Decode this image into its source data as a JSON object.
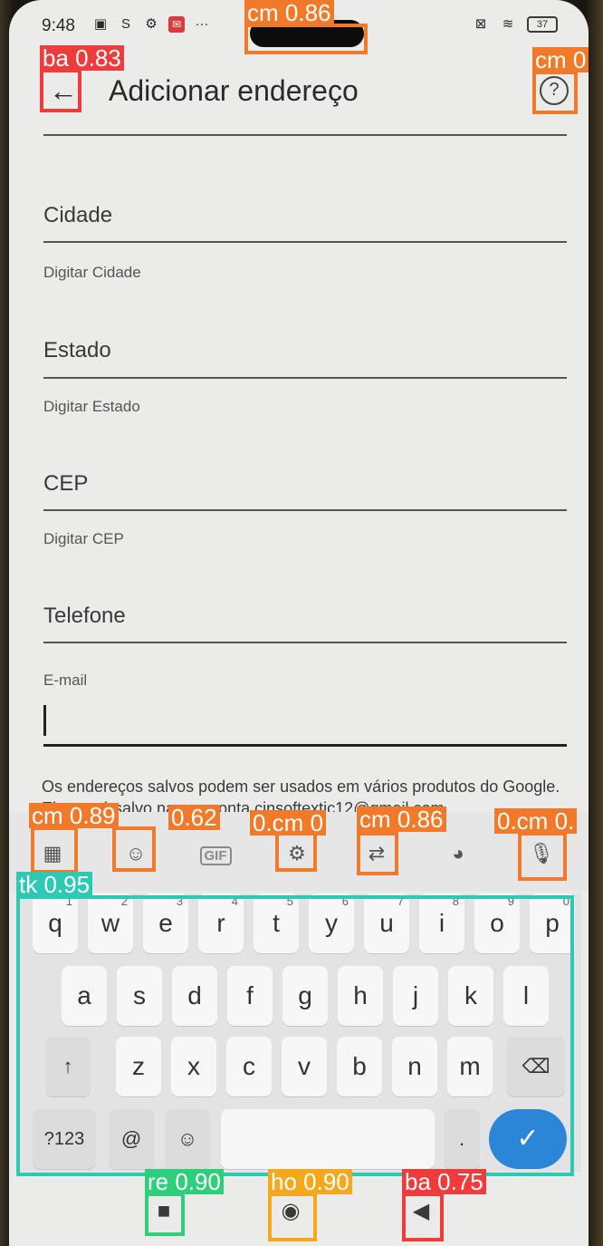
{
  "status": {
    "time": "9:48",
    "battery": "37",
    "left_icons": [
      "nfc-icon",
      "s-icon",
      "gear-icon",
      "mail-icon",
      "more-icon"
    ],
    "right_icons": [
      "sim-icon",
      "wifi-icon",
      "battery-icon"
    ]
  },
  "app_bar": {
    "title": "Adicionar endereço"
  },
  "form": {
    "cidade_label": "Cidade",
    "cidade_hint": "Digitar Cidade",
    "estado_label": "Estado",
    "estado_hint": "Digitar Estado",
    "cep_label": "CEP",
    "cep_hint": "Digitar CEP",
    "telefone_label": "Telefone",
    "email_label": "E-mail",
    "email_value": "",
    "disclaimer": "Os endereços salvos podem ser usados em vários produtos do Google. Eles será salvo na sua conta cinsoftextic12@gmail.com"
  },
  "keyboard": {
    "row1": [
      {
        "k": "q",
        "n": "1"
      },
      {
        "k": "w",
        "n": "2"
      },
      {
        "k": "e",
        "n": "3"
      },
      {
        "k": "r",
        "n": "4"
      },
      {
        "k": "t",
        "n": "5"
      },
      {
        "k": "y",
        "n": "6"
      },
      {
        "k": "u",
        "n": "7"
      },
      {
        "k": "i",
        "n": "8"
      },
      {
        "k": "o",
        "n": "9"
      },
      {
        "k": "p",
        "n": "0"
      }
    ],
    "row2": [
      "a",
      "s",
      "d",
      "f",
      "g",
      "h",
      "j",
      "k",
      "l"
    ],
    "row3": [
      "z",
      "x",
      "c",
      "v",
      "b",
      "n",
      "m"
    ],
    "symbols_key": "?123",
    "at_key": "@",
    "period_key": "."
  },
  "overlays": [
    {
      "label": "cm 0.86",
      "color": "#f07a2a"
    },
    {
      "label": "ba 0.83",
      "color": "#ee3b3b"
    },
    {
      "label": "cm 0",
      "color": "#f07a2a"
    },
    {
      "label": "cm 0.89",
      "color": "#f07a2a"
    },
    {
      "label": "0.62",
      "color": "#f07a2a"
    },
    {
      "label": "0.cm 0",
      "color": "#f07a2a"
    },
    {
      "label": "cm 0.86",
      "color": "#f07a2a"
    },
    {
      "label": "0.cm 0.",
      "color": "#f07a2a"
    },
    {
      "label": "tk 0.95",
      "color": "#2ec9b5"
    },
    {
      "label": "re 0.90",
      "color": "#2ecf7a"
    },
    {
      "label": "ho 0.90",
      "color": "#f5a81c"
    },
    {
      "label": "ba 0.75",
      "color": "#ee3b3b"
    }
  ]
}
